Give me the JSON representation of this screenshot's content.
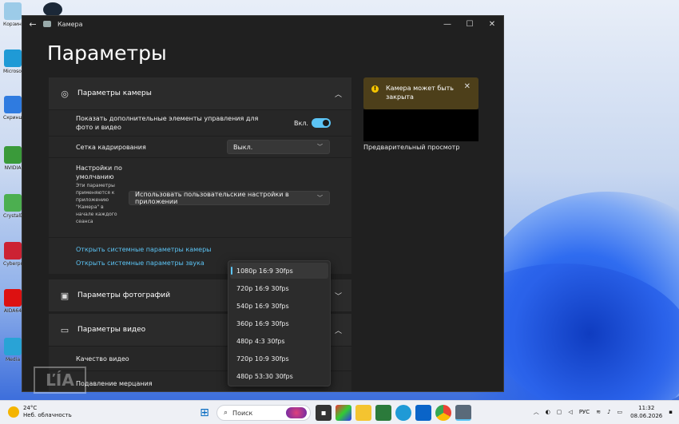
{
  "window": {
    "title": "Камера",
    "page_title": "Параметры",
    "back_glyph": "←",
    "minimize_glyph": "—",
    "maximize_glyph": "☐",
    "close_glyph": "✕"
  },
  "camera_settings": {
    "header": "Параметры камеры",
    "show_controls_label": "Показать дополнительные элементы управления для фото и видео",
    "show_controls_state": "Вкл.",
    "show_controls_on": true,
    "grid_label": "Сетка кадрирования",
    "grid_value": "Выкл.",
    "defaults_title": "Настройки по умолчанию",
    "defaults_desc": "Эти параметры применяются к приложению \"Камера\" в начале каждого сеанса",
    "defaults_value": "Использовать пользовательские настройки в приложении",
    "link_camera": "Открыть системные параметры камеры",
    "link_sound": "Открыть системные параметры звука"
  },
  "photo_settings": {
    "header": "Параметры фотографий"
  },
  "video_settings": {
    "header": "Параметры видео",
    "quality_label": "Качество видео",
    "flicker_label": "Подавление мерцания"
  },
  "resolution_options": [
    "1080p 16:9 30fps",
    "720p 16:9 30fps",
    "540p 16:9 30fps",
    "360p 16:9 30fps",
    "480p 4:3 30fps",
    "720p 10:9 30fps",
    "480p 53:30 30fps"
  ],
  "selected_resolution": "1080p 16:9 30fps",
  "notice": {
    "message": "Камера может быть закрыта",
    "warn_glyph": "!",
    "close_glyph": "✕"
  },
  "preview_label": "Предварительный просмотр",
  "watermark_text": "ĽÍA",
  "desktop_icons": [
    {
      "label": "Корзина",
      "icon": "recycle-bin-icon",
      "color": "#9ccbe8"
    },
    {
      "label": "Microsoft Edge",
      "icon": "edge-icon",
      "color": "#1f9ad6"
    },
    {
      "label": "Скриншот",
      "icon": "snip-icon",
      "color": "#2f7be0"
    },
    {
      "label": "NVIDIA",
      "icon": "nvidia-icon",
      "color": "#3a9a3a"
    },
    {
      "label": "CrystalDisk",
      "icon": "crystal-icon",
      "color": "#4caf50"
    },
    {
      "label": "Cyberpunk",
      "icon": "game-icon",
      "color": "#c23"
    },
    {
      "label": "AIDA64",
      "icon": "aida-icon",
      "color": "#d11"
    },
    {
      "label": "Media",
      "icon": "media-icon",
      "color": "#29a3d6"
    }
  ],
  "taskbar": {
    "temperature": "24°C",
    "weather": "Неб. облачность",
    "search_placeholder": "Поиск",
    "language": "РУС",
    "time": "11:32",
    "date": "08.06.2026"
  },
  "colors": {
    "accent": "#5cc4f5",
    "warning": "#f5c400",
    "window_bg": "#202020",
    "panel_bg": "#2b2b2b"
  }
}
